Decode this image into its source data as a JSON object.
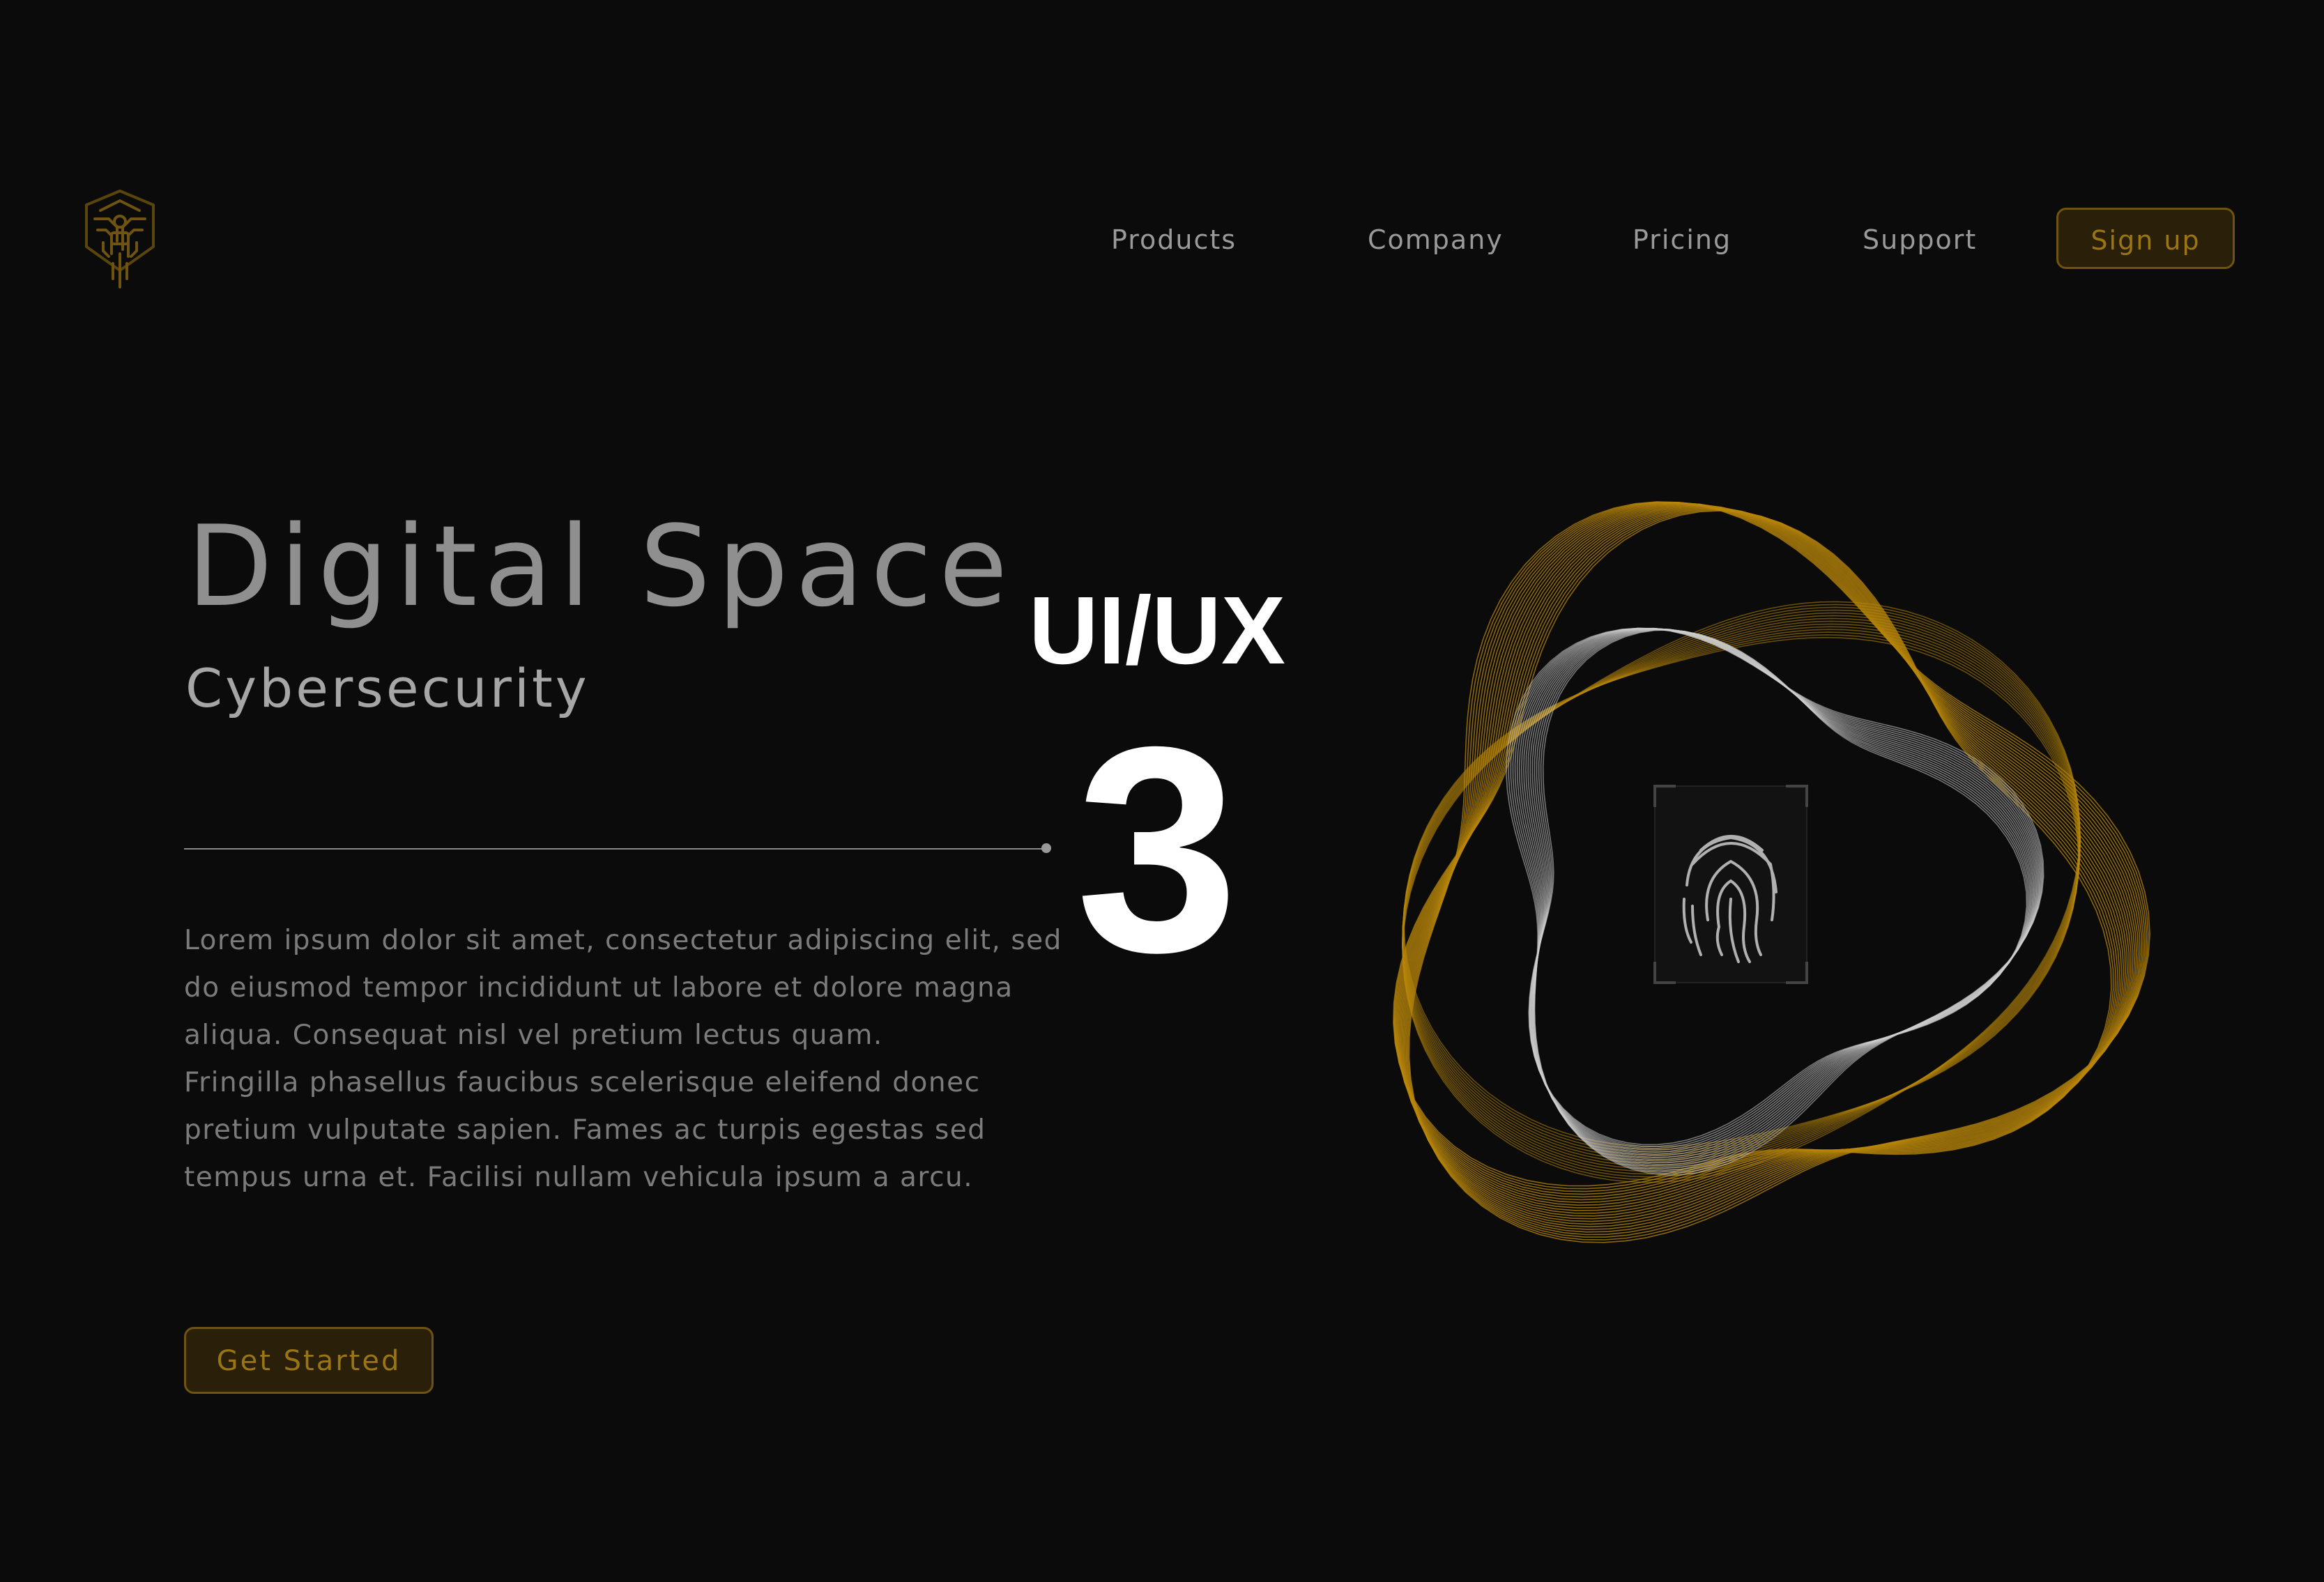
{
  "nav": {
    "items": [
      "Products",
      "Company",
      "Pricing",
      "Support"
    ],
    "signup_label": "Sign up"
  },
  "hero": {
    "title": "Digital Space",
    "subtitle": "Cybersecurity",
    "body_lines": [
      "Lorem ipsum dolor sit amet, consectetur adipiscing elit, sed",
      "do eiusmod tempor incididunt ut labore et dolore magna",
      "aliqua. Consequat nisl vel pretium lectus quam.",
      "Fringilla phasellus faucibus scelerisque eleifend donec",
      "pretium vulputate sapien. Fames ac turpis egestas sed",
      "tempus urna et. Facilisi nullam vehicula ipsum a arcu."
    ],
    "cta_label": "Get Started"
  },
  "overlay": {
    "label": "UI/UX",
    "number": "3"
  },
  "icons": {
    "logo": "circuit-shield-logo-icon",
    "art": "fingerprint-icon"
  },
  "colors": {
    "background": "#0b0b0b",
    "accent_gold": "#b8860b",
    "button_border": "#6e5410",
    "button_text": "#9a7514",
    "nav_text": "#9a9a9a",
    "title_text": "#8f8f8f",
    "body_text": "#7b7b7b",
    "overlay_text": "#ffffff"
  }
}
